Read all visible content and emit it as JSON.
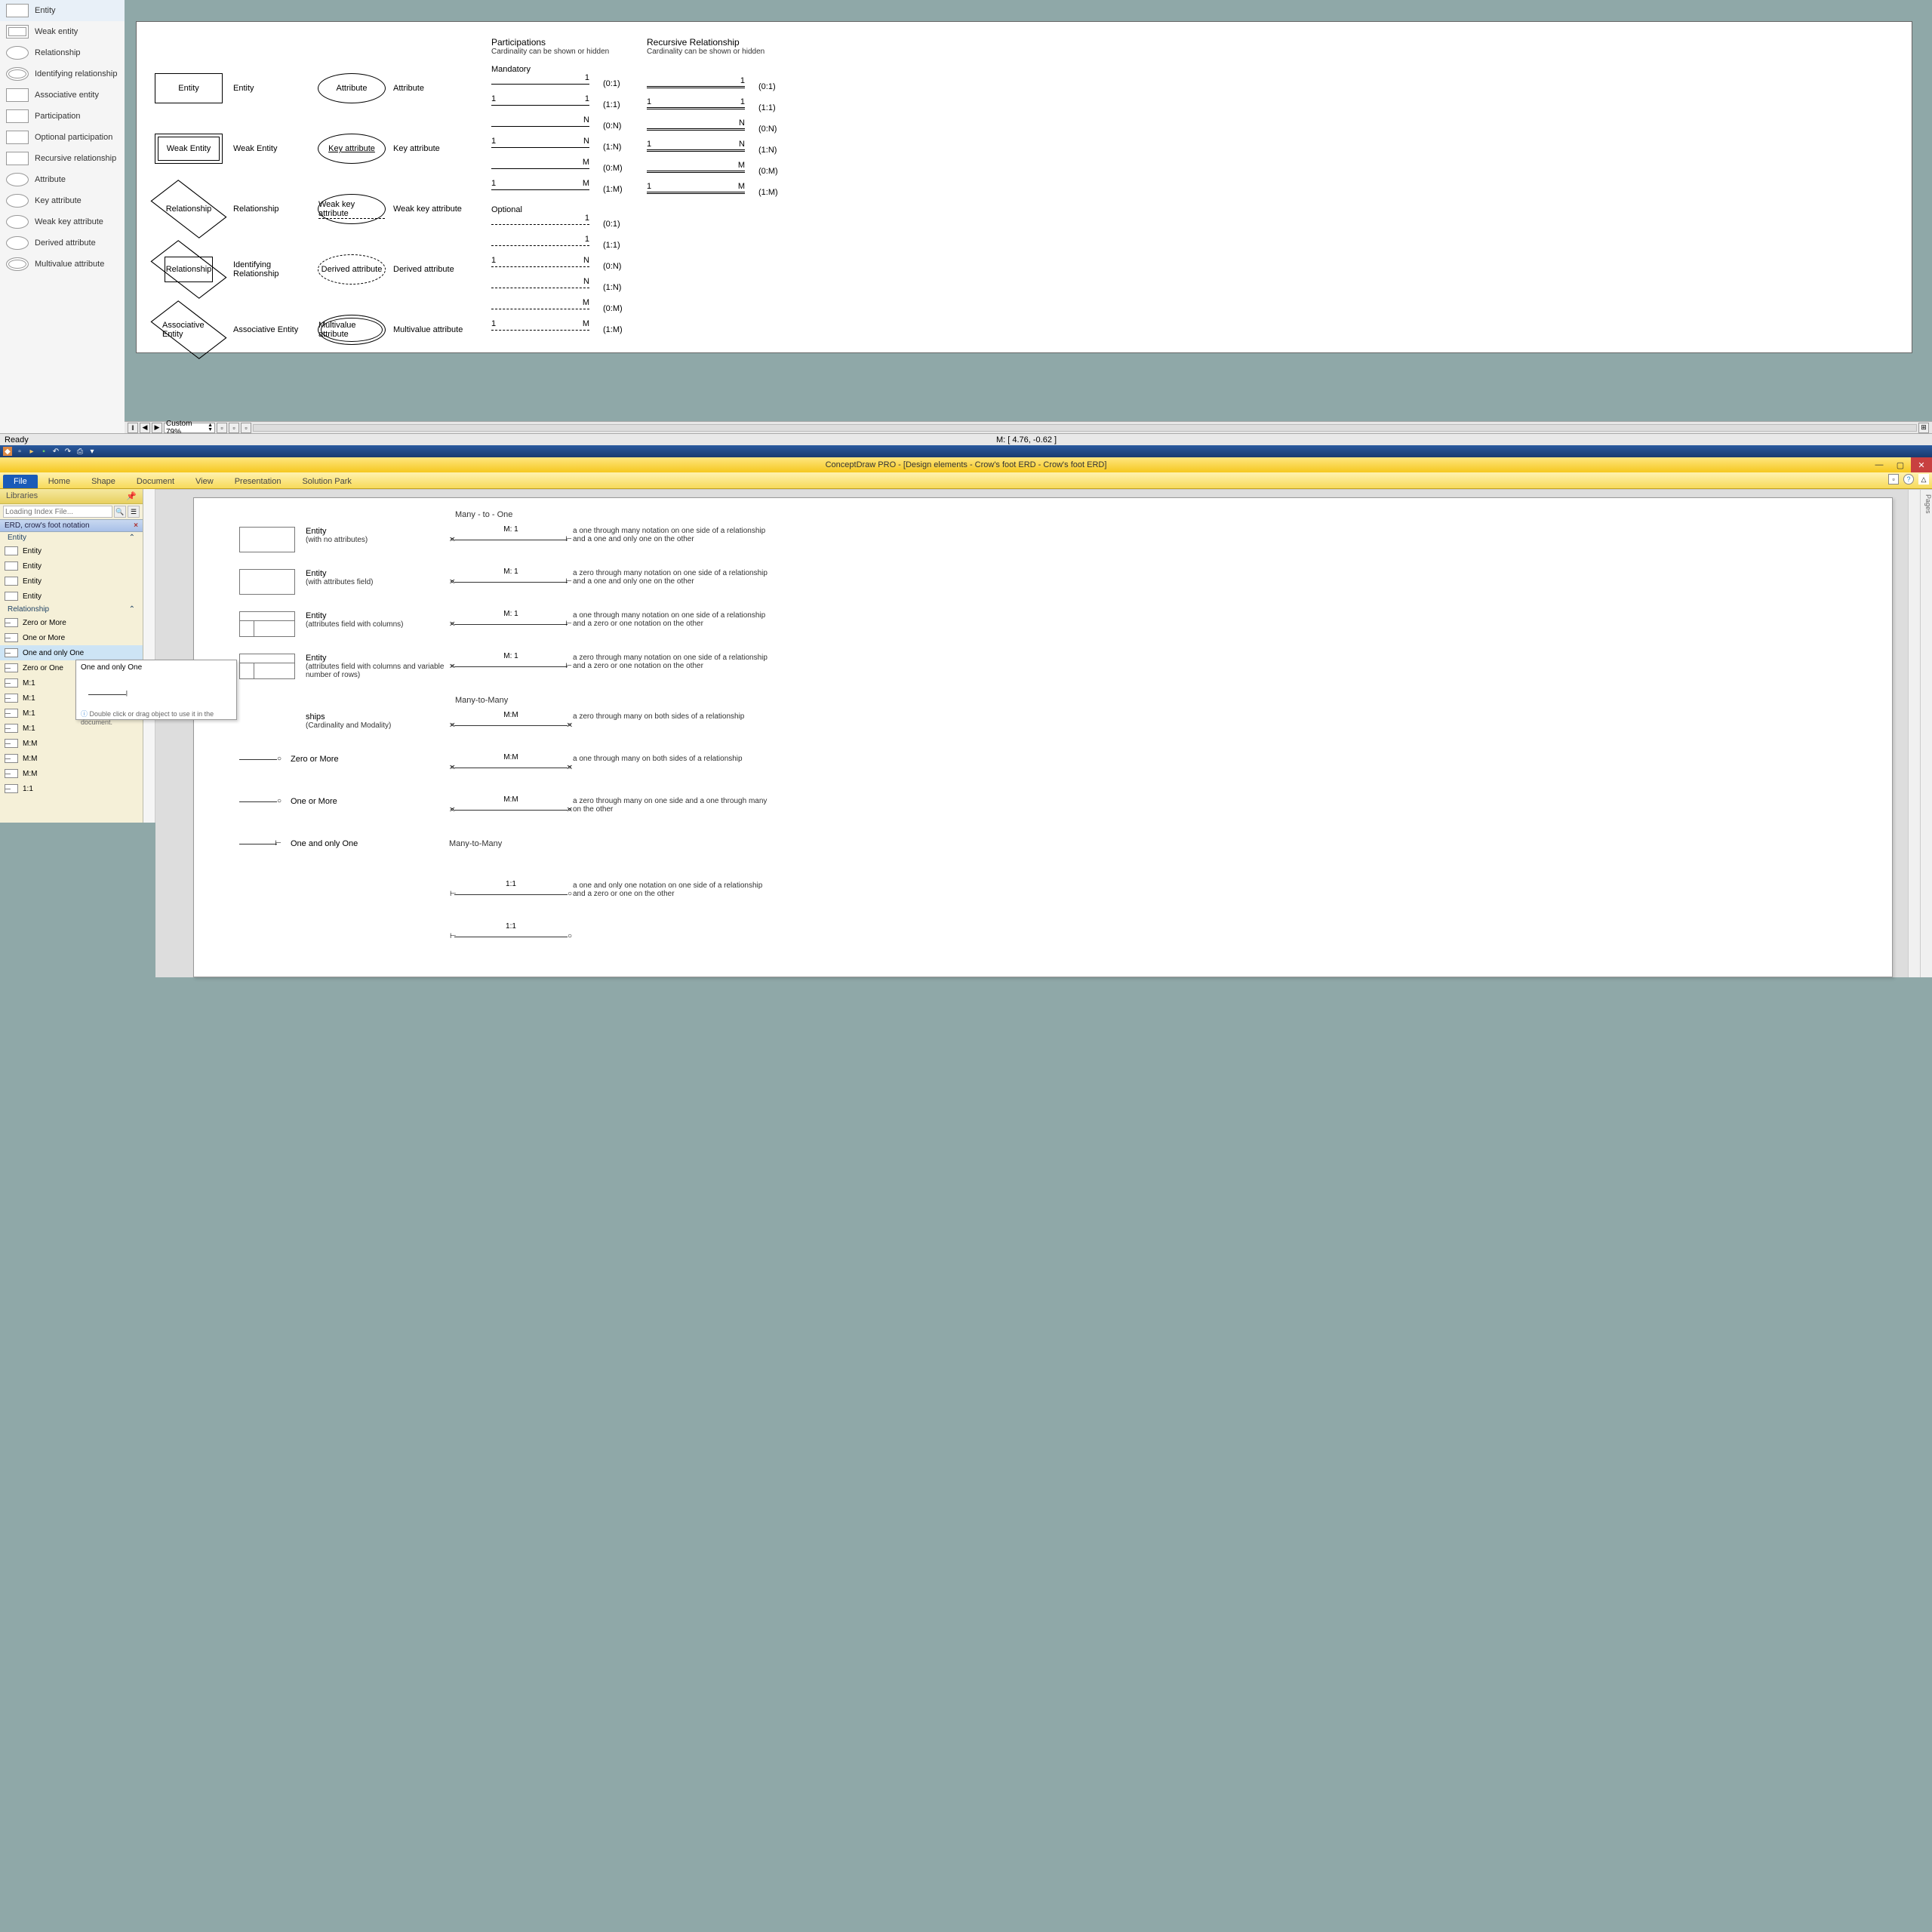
{
  "top": {
    "palette": [
      {
        "label": "Entity",
        "shape": "rect"
      },
      {
        "label": "Weak entity",
        "shape": "rect double"
      },
      {
        "label": "Relationship",
        "shape": "ellipse"
      },
      {
        "label": "Identifying relationship",
        "shape": "ellipse double"
      },
      {
        "label": "Associative entity",
        "shape": "diamond"
      },
      {
        "label": "Participation",
        "shape": "rect"
      },
      {
        "label": "Optional participation",
        "shape": "rect"
      },
      {
        "label": "Recursive relationship",
        "shape": "rect"
      },
      {
        "label": "Attribute",
        "shape": "ellipse"
      },
      {
        "label": "Key attribute",
        "shape": "ellipse"
      },
      {
        "label": "Weak key attribute",
        "shape": "ellipse"
      },
      {
        "label": "Derived attribute",
        "shape": "ellipse"
      },
      {
        "label": "Multivalue attribute",
        "shape": "ellipse double"
      }
    ],
    "shapes": [
      {
        "col1": "Entity",
        "col1style": "rect",
        "col2": "Entity",
        "col3": "Attribute",
        "col3style": "ellipse",
        "col4": "Attribute"
      },
      {
        "col1": "Weak Entity",
        "col1style": "rect double",
        "col2": "Weak Entity",
        "col3": "Key attribute",
        "col3style": "ellipse",
        "col3extra": "underline",
        "col4": "Key attribute"
      },
      {
        "col1": "Relationship",
        "col1style": "diamond",
        "col2": "Relationship",
        "col3": "Weak key attribute",
        "col3style": "ellipse",
        "col3extra": "dashed-underline",
        "col4": "Weak key attribute"
      },
      {
        "col1": "Relationship",
        "col1style": "diamond double",
        "col2": "Identifying Relationship",
        "col3": "Derived attribute",
        "col3style": "ellipse dashed",
        "col4": "Derived attribute"
      },
      {
        "col1": "Associative Entity",
        "col1style": "rect diamond-inside",
        "col2": "Associative Entity",
        "col3": "Multivalue attribute",
        "col3style": "ellipse double",
        "col4": "Multivalue attribute"
      }
    ],
    "participations": {
      "title": "Participations",
      "subtitle": "Cardinality can be shown or hidden",
      "mandatory_title": "Mandatory",
      "mandatory": [
        {
          "l": "",
          "r": "1",
          "lab": "(0:1)"
        },
        {
          "l": "1",
          "r": "1",
          "lab": "(1:1)"
        },
        {
          "l": "",
          "r": "N",
          "lab": "(0:N)"
        },
        {
          "l": "1",
          "r": "N",
          "lab": "(1:N)"
        },
        {
          "l": "",
          "r": "M",
          "lab": "(0:M)"
        },
        {
          "l": "1",
          "r": "M",
          "lab": "(1:M)"
        }
      ],
      "optional_title": "Optional",
      "optional": [
        {
          "l": "",
          "r": "1",
          "lab": "(0:1)"
        },
        {
          "l": "",
          "r": "1",
          "lab": "(1:1)"
        },
        {
          "l": "1",
          "r": "N",
          "lab": "(0:N)"
        },
        {
          "l": "",
          "r": "N",
          "lab": "(1:N)"
        },
        {
          "l": "",
          "r": "M",
          "lab": "(0:M)"
        },
        {
          "l": "1",
          "r": "M",
          "lab": "(1:M)"
        }
      ]
    },
    "recursive": {
      "title": "Recursive Relationship",
      "subtitle": "Cardinality can be shown or hidden",
      "items": [
        {
          "l": "",
          "r": "1",
          "lab": "(0:1)"
        },
        {
          "l": "1",
          "r": "1",
          "lab": "(1:1)"
        },
        {
          "l": "",
          "r": "N",
          "lab": "(0:N)"
        },
        {
          "l": "1",
          "r": "N",
          "lab": "(1:N)"
        },
        {
          "l": "",
          "r": "M",
          "lab": "(0:M)"
        },
        {
          "l": "1",
          "r": "M",
          "lab": "(1:M)"
        }
      ]
    },
    "status": {
      "ready": "Ready",
      "coords": "M: [ 4.76, -0.62 ]",
      "zoom": "Custom 79%"
    }
  },
  "bottom": {
    "title": "ConceptDraw PRO - [Design elements - Crow's foot ERD - Crow's foot ERD]",
    "ribbon": [
      "Home",
      "Shape",
      "Document",
      "View",
      "Presentation",
      "Solution Park"
    ],
    "file_tab": "File",
    "libraries": {
      "title": "Libraries",
      "search_placeholder": "Loading Index File...",
      "category": "ERD, crow's foot notation",
      "entity_group": "Entity",
      "entity_items": [
        "Entity",
        "Entity",
        "Entity",
        "Entity"
      ],
      "rel_group": "Relationship",
      "rel_items": [
        {
          "label": "Zero or More"
        },
        {
          "label": "One or More"
        },
        {
          "label": "One and only One",
          "selected": true
        },
        {
          "label": "Zero or One"
        },
        {
          "label": "M:1"
        },
        {
          "label": "M:1"
        },
        {
          "label": "M:1"
        },
        {
          "label": "M:1"
        },
        {
          "label": "M:M"
        },
        {
          "label": "M:M"
        },
        {
          "label": "M:M"
        },
        {
          "label": "1:1"
        }
      ]
    },
    "tooltip": {
      "title": "One and only One",
      "hint": "Double click or drag object to use it in the document."
    },
    "canvas": {
      "sec1": "Many - to - One",
      "entities": [
        {
          "name": "Entity",
          "desc": "(with no attributes)",
          "style": ""
        },
        {
          "name": "Entity",
          "desc": "(with attributes field)",
          "style": "split"
        },
        {
          "name": "Entity",
          "desc": "(attributes field with columns)",
          "style": "cols"
        },
        {
          "name": "Entity",
          "desc": "(attributes field with columns and variable number of rows)",
          "style": "cols"
        }
      ],
      "m1": [
        {
          "ratio": "M: 1",
          "desc": "a one through many notation on one side of a relationship and a one and only one on the other"
        },
        {
          "ratio": "M: 1",
          "desc": "a zero through many notation on one side of a relationship and a one and only one on the other"
        },
        {
          "ratio": "M: 1",
          "desc": "a one through many notation on one side of a relationship and a zero or one notation on the other"
        },
        {
          "ratio": "M: 1",
          "desc": "a zero through many notation on one side of a relationship and a zero or one notation on the other"
        }
      ],
      "sec2": "Many-to-Many",
      "mm": [
        {
          "ratio": "M:M",
          "desc": "a zero through many on both sides of a relationship"
        },
        {
          "ratio": "M:M",
          "desc": "a one through many on both sides of a relationship"
        },
        {
          "ratio": "M:M",
          "desc": "a zero through many on one side and a one through many on the other"
        }
      ],
      "relshapes_title": "ships",
      "relshapes_desc": "(Cardinality and Modality)",
      "relshapes": [
        {
          "label": "Zero or More"
        },
        {
          "label": "One or More"
        },
        {
          "label": "One and only One"
        }
      ],
      "sec3": "Many-to-Many",
      "oo": [
        {
          "ratio": "1:1",
          "desc": "a one and only one notation on one side of a relationship and a zero or one on the other"
        },
        {
          "ratio": "1:1",
          "desc": ""
        }
      ]
    },
    "pages_tab": "Pages"
  }
}
